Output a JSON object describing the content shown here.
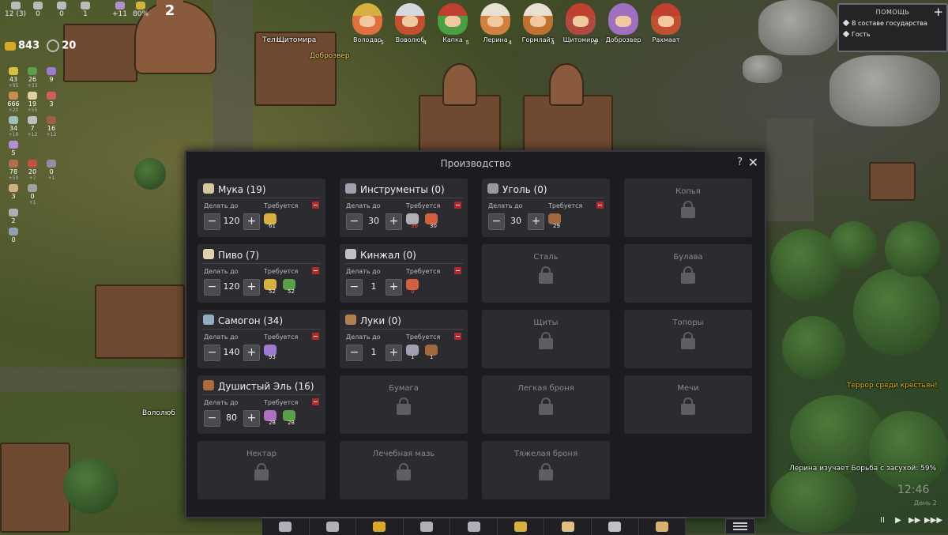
{
  "top_stats": [
    {
      "value": "12 (3)"
    },
    {
      "value": "0"
    },
    {
      "value": "0"
    },
    {
      "value": "1"
    },
    {
      "value": "+11"
    },
    {
      "value": "80%"
    }
  ],
  "level": "2",
  "money": "843",
  "crystals": "20",
  "resources": [
    {
      "value": "43",
      "sub": "+95",
      "color": "#d8c040"
    },
    {
      "value": "26",
      "sub": "+33",
      "color": "#5aa04a"
    },
    {
      "value": "9",
      "sub": "",
      "color": "#a07ad0"
    },
    {
      "value": "666",
      "sub": "+20",
      "color": "#c89050"
    },
    {
      "value": "19",
      "sub": "+55",
      "color": "#e0d0a0"
    },
    {
      "value": "3",
      "sub": "",
      "color": "#d06060"
    },
    {
      "value": "34",
      "sub": "+18",
      "color": "#a0c0c0"
    },
    {
      "value": "7",
      "sub": "+12",
      "color": "#c0c0c0"
    },
    {
      "value": "16",
      "sub": "+12",
      "color": "#a06040"
    },
    {
      "value": "5",
      "sub": "",
      "color": "#b090d0"
    },
    {
      "value": "",
      "sub": "",
      "color": "transparent"
    },
    {
      "value": "",
      "sub": "",
      "color": "transparent"
    },
    {
      "value": "78",
      "sub": "+50",
      "color": "#b07050"
    },
    {
      "value": "20",
      "sub": "+7",
      "color": "#c05040"
    },
    {
      "value": "0",
      "sub": "+1",
      "color": "#9090a0"
    },
    {
      "value": "3",
      "sub": "",
      "color": "#d0b080"
    },
    {
      "value": "0",
      "sub": "+1",
      "color": "#a0a0a0"
    },
    {
      "value": "",
      "sub": "",
      "color": "transparent"
    },
    {
      "value": "2",
      "sub": "",
      "color": "#b0b0b0"
    },
    {
      "value": "",
      "sub": "",
      "color": "transparent"
    },
    {
      "value": "",
      "sub": "",
      "color": "transparent"
    },
    {
      "value": "0",
      "sub": "",
      "color": "#90a0b0"
    }
  ],
  "portraits": [
    {
      "name": "Володар",
      "level": "5",
      "face": "#e07040"
    },
    {
      "name": "Воволюб",
      "level": "4",
      "face": "#c05030"
    },
    {
      "name": "Капка",
      "level": "5",
      "face": "#4aa040"
    },
    {
      "name": "Лерина",
      "level": "4",
      "face": "#d08040"
    },
    {
      "name": "Гормлайт",
      "level": "4",
      "face": "#c07030"
    },
    {
      "name": "Щитомира",
      "level": "5",
      "face": "#b04a40"
    },
    {
      "name": "Доброзвер",
      "level": "",
      "face": "#a070c0"
    },
    {
      "name": "Рахмаат",
      "level": "",
      "face": "#c05030"
    }
  ],
  "map_labels": {
    "teli": "Тели",
    "shitomira": "Щитомира",
    "dobrover": "Доброзвер",
    "volyub": "Вололюб"
  },
  "help": {
    "title": "ПОМОЩЬ",
    "plus": "+",
    "items": [
      "В составе государства",
      "Гость"
    ]
  },
  "dialog": {
    "title": "Производство",
    "help_label": "?",
    "close_label": "✕",
    "make_label": "Делать до",
    "req_label": "Требуется",
    "minus": "−",
    "plus": "+",
    "recipes": [
      {
        "title": "Мука (19)",
        "qty": "120",
        "icon_color": "#d8c8a0",
        "req": [
          {
            "color": "#d8b040",
            "num": "61",
            "low": false
          }
        ]
      },
      {
        "title": "Инструменты (0)",
        "qty": "30",
        "icon_color": "#a0a0b0",
        "req": [
          {
            "color": "#b0b0b8",
            "num": "30",
            "low": true
          },
          {
            "color": "#d06040",
            "num": "30",
            "low": false
          }
        ]
      },
      {
        "title": "Уголь (0)",
        "qty": "30",
        "icon_color": "#9a9aa0",
        "req": [
          {
            "color": "#a06a40",
            "num": "29",
            "low": false
          }
        ]
      },
      {
        "title": "Пиво (7)",
        "qty": "120",
        "icon_color": "#e0d0b0",
        "req": [
          {
            "color": "#d8b040",
            "num": "52",
            "low": false
          },
          {
            "color": "#5aa04a",
            "num": "52",
            "low": false
          }
        ]
      },
      {
        "title": "Кинжал (0)",
        "qty": "1",
        "icon_color": "#c0c0c8",
        "req": [
          {
            "color": "#d06040",
            "num": "0",
            "low": true
          }
        ]
      },
      {
        "title": "Самогон (34)",
        "qty": "140",
        "icon_color": "#90b0c0",
        "req": [
          {
            "color": "#a07ad0",
            "num": "93",
            "low": false
          }
        ]
      },
      {
        "title": "Луки (0)",
        "qty": "1",
        "icon_color": "#b08050",
        "req": [
          {
            "color": "#a0a0b0",
            "num": "1",
            "low": false
          },
          {
            "color": "#a06a40",
            "num": "1",
            "low": false
          }
        ]
      },
      {
        "title": "Душистый Эль (16)",
        "qty": "80",
        "icon_color": "#b06a40",
        "req": [
          {
            "color": "#b070c0",
            "num": "28",
            "low": false
          },
          {
            "color": "#5aa04a",
            "num": "28",
            "low": false
          }
        ]
      }
    ],
    "locked": [
      "Копья",
      "Сталь",
      "Булава",
      "Щиты",
      "Топоры",
      "Бумага",
      "Легкая броня",
      "Мечи",
      "Нектар",
      "Лечебная мазь",
      "Тяжелая броня"
    ]
  },
  "notices": {
    "terror": "Террор среди крестьян!",
    "research": "Лерина изучает Борьба с засухой: 59%",
    "clock": "12:46",
    "day": "День 2",
    "terror_color": "#e8b020"
  },
  "speed": [
    "II",
    "▶",
    "▶▶",
    "▶▶▶"
  ],
  "toolbar_icons": [
    "hammer-icon",
    "gear-icon",
    "money-bag-icon",
    "bar-chart-icon",
    "swords-icon",
    "crown-icon",
    "book-icon",
    "scales-icon",
    "map-icon"
  ]
}
